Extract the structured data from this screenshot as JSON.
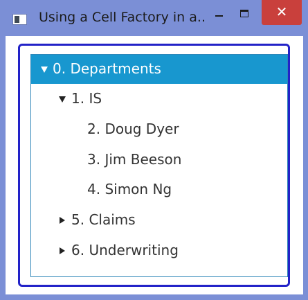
{
  "window": {
    "title": "Using a Cell Factory in a...",
    "close_glyph": "✕",
    "icons": {
      "app": "app-window-icon",
      "minimize": "minimize-icon",
      "maximize": "maximize-icon",
      "close": "close-icon"
    },
    "colors": {
      "frame": "#7b8fd6",
      "close": "#c9403c",
      "selection": "#1897cf",
      "outer_border": "#2222c8",
      "tree_border": "#2f86b8"
    }
  },
  "tree": {
    "items": [
      {
        "label": "0. Departments",
        "expanded": true,
        "selected": true
      },
      {
        "label": "1. IS",
        "expanded": true,
        "selected": false
      },
      {
        "label": "2. Doug Dyer",
        "selected": false
      },
      {
        "label": "3. Jim Beeson",
        "selected": false
      },
      {
        "label": "4. Simon Ng",
        "selected": false
      },
      {
        "label": "5. Claims",
        "expanded": false,
        "selected": false
      },
      {
        "label": "6. Underwriting",
        "expanded": false,
        "selected": false
      }
    ]
  }
}
